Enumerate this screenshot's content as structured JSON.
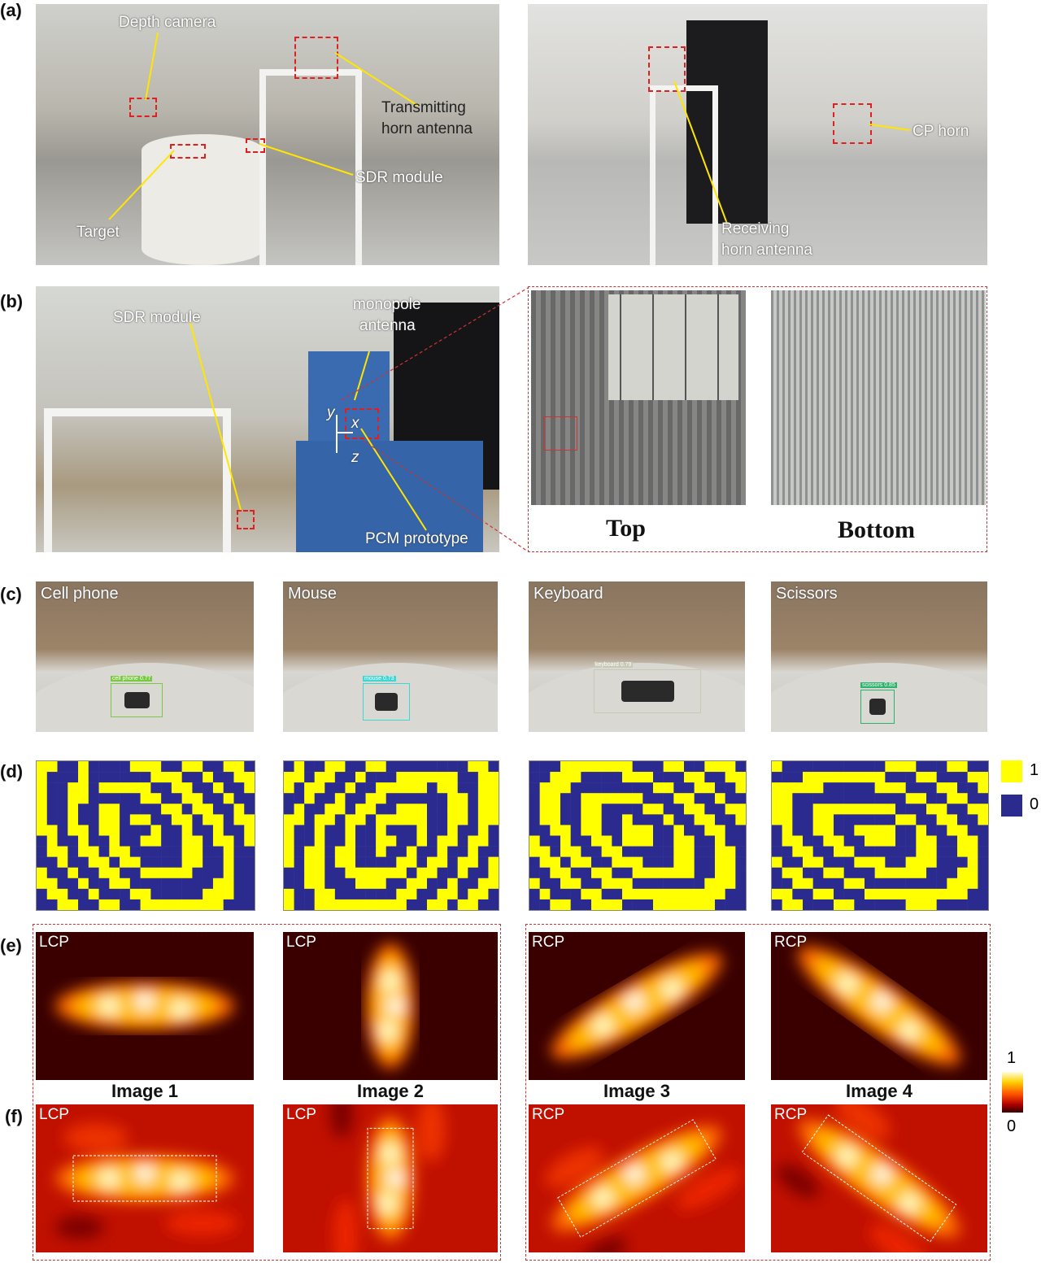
{
  "panels": {
    "a": "(a)",
    "b": "(b)",
    "c": "(c)",
    "d": "(d)",
    "e": "(e)",
    "f": "(f)"
  },
  "a_annotations": {
    "depth_camera": "Depth camera",
    "tx_horn_1": "Transmitting",
    "tx_horn_2": "horn antenna",
    "sdr": "SDR module",
    "target": "Target",
    "cp_horn": "CP horn",
    "rx_horn_1": "Receiving",
    "rx_horn_2": "horn antenna"
  },
  "b_annotations": {
    "sdr": "SDR module",
    "monopole_1": "monopole",
    "monopole_2": "antenna",
    "pcm": "PCM prototype",
    "axis_x": "x",
    "axis_y": "y",
    "axis_z": "z",
    "top": "Top",
    "bottom": "Bottom"
  },
  "objects": [
    {
      "name": "Cell phone",
      "detection": "cell phone  0.77",
      "color": "#7ac943"
    },
    {
      "name": "Mouse",
      "detection": "mouse  0.73",
      "color": "#3fd6d6"
    },
    {
      "name": "Keyboard",
      "detection": "keyboard  0.79",
      "color": "#c8c8b4"
    },
    {
      "name": "Scissors",
      "detection": "scissors  0.85",
      "color": "#2bb36b"
    }
  ],
  "coding_legend": {
    "one": "1",
    "zero": "0",
    "one_color": "#ffff00",
    "zero_color": "#2b2b8f"
  },
  "images": [
    {
      "pol": "LCP",
      "label": "Image 1"
    },
    {
      "pol": "LCP",
      "label": "Image 2"
    },
    {
      "pol": "RCP",
      "label": "Image 3"
    },
    {
      "pol": "RCP",
      "label": "Image 4"
    }
  ],
  "colorbar": {
    "max": "1",
    "min": "0"
  }
}
